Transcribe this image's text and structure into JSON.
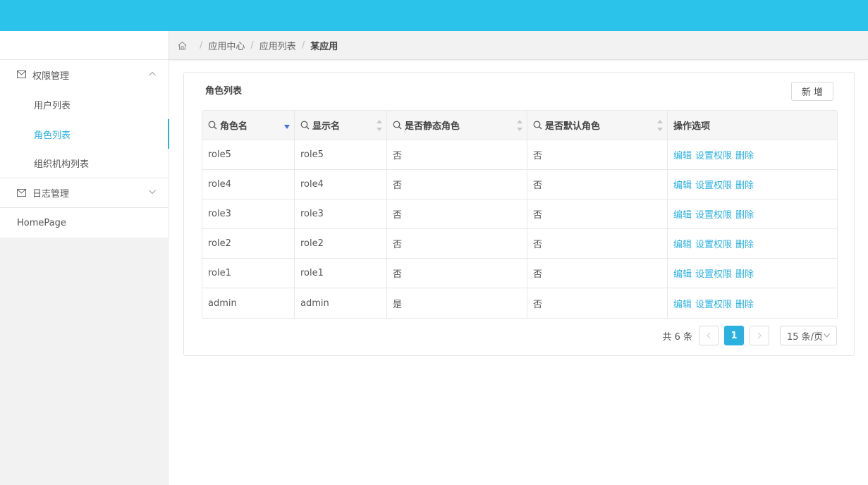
{
  "colors": {
    "header": "#2bc3ea",
    "accent": "#2bb1e0",
    "sort_active": "#4a6ee0"
  },
  "sidebar": {
    "groups": [
      {
        "label": "权限管理",
        "icon": "mail-icon",
        "expanded": true,
        "items": [
          {
            "label": "用户列表",
            "active": false
          },
          {
            "label": "角色列表",
            "active": true
          },
          {
            "label": "组织机构列表",
            "active": false
          }
        ]
      },
      {
        "label": "日志管理",
        "icon": "mail-icon",
        "expanded": false,
        "items": []
      }
    ],
    "home_label": "HomePage"
  },
  "breadcrumb": {
    "icon": "home-icon",
    "items": [
      "应用中心",
      "应用列表",
      "某应用"
    ]
  },
  "card": {
    "title": "角色列表",
    "add_label": "新 增"
  },
  "table": {
    "columns": [
      {
        "label": "角色名",
        "searchable": true,
        "sort": "descending"
      },
      {
        "label": "显示名",
        "searchable": true,
        "sort": "none"
      },
      {
        "label": "是否静态角色",
        "searchable": true,
        "sort": "none"
      },
      {
        "label": "是否默认角色",
        "searchable": true,
        "sort": "none"
      },
      {
        "label": "操作选项",
        "searchable": false,
        "sort": null
      }
    ],
    "rows": [
      {
        "name": "role5",
        "display": "role5",
        "static": "否",
        "default": "否"
      },
      {
        "name": "role4",
        "display": "role4",
        "static": "否",
        "default": "否"
      },
      {
        "name": "role3",
        "display": "role3",
        "static": "否",
        "default": "否"
      },
      {
        "name": "role2",
        "display": "role2",
        "static": "否",
        "default": "否"
      },
      {
        "name": "role1",
        "display": "role1",
        "static": "否",
        "default": "否"
      },
      {
        "name": "admin",
        "display": "admin",
        "static": "是",
        "default": "否"
      }
    ],
    "actions": [
      "编辑",
      "设置权限",
      "删除"
    ]
  },
  "pagination": {
    "total_text": "共 6 条",
    "current_page": "1",
    "page_size": "15 条/页"
  }
}
